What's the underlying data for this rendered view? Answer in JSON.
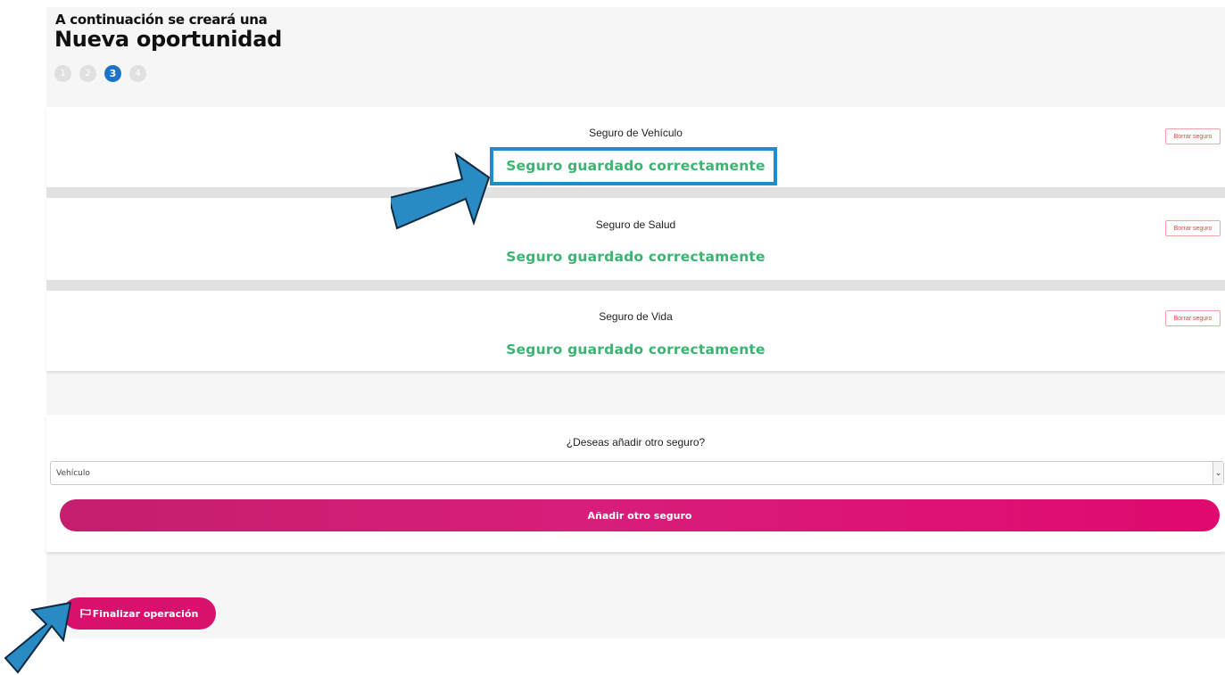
{
  "header": {
    "pre_title": "A continuación se creará una",
    "title": "Nueva oportunidad",
    "steps": [
      "1",
      "2",
      "3",
      "4"
    ],
    "active_step": 3
  },
  "insurances": [
    {
      "title": "Seguro de Vehículo",
      "status": "Seguro guardado correctamente",
      "delete_label": "Borrar seguro"
    },
    {
      "title": "Seguro de Salud",
      "status": "Seguro guardado correctamente",
      "delete_label": "Borrar seguro"
    },
    {
      "title": "Seguro de Vida",
      "status": "Seguro guardado correctamente",
      "delete_label": "Borrar seguro"
    }
  ],
  "add_section": {
    "question": "¿Deseas añadir otro seguro?",
    "select_value": "Vehículo",
    "add_button": "Añadir otro seguro"
  },
  "footer": {
    "finish_button": "Finalizar operación",
    "finish_icon": "flag-icon"
  },
  "colors": {
    "accent": "#d8116e",
    "success": "#3cb371",
    "active_step": "#1f73c7",
    "annotation": "#1e8fc6"
  }
}
